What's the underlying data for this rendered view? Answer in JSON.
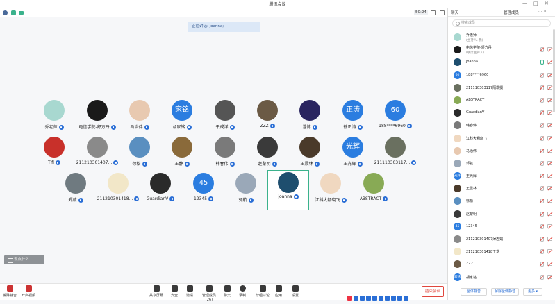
{
  "window": {
    "title": "腾讯会议"
  },
  "toolbar": {
    "timer": "50:24"
  },
  "speaking": {
    "label": "正在讲话: joanna;"
  },
  "participants": [
    {
      "name": "乔老师",
      "avatar_text": "",
      "color": "#a8d8d0"
    },
    {
      "name": "电信学院-舒方丹",
      "avatar_text": "",
      "color": "#1a1a1a"
    },
    {
      "name": "马治伟",
      "avatar_text": "",
      "color": "#e8c9b0"
    },
    {
      "name": "胡家铭",
      "avatar_text": "家铭",
      "color": "#2b7de0"
    },
    {
      "name": "于成洋",
      "avatar_text": "",
      "color": "#555555"
    },
    {
      "name": "ZZZ",
      "avatar_text": "",
      "color": "#6b5a45"
    },
    {
      "name": "潘博",
      "avatar_text": "",
      "color": "#2a2560"
    },
    {
      "name": "徐正涛",
      "avatar_text": "正涛",
      "color": "#2b7de0"
    },
    {
      "name": "188****6960",
      "avatar_text": "60",
      "color": "#2b7de0"
    },
    {
      "name": "Tifl",
      "avatar_text": "",
      "color": "#c8302a"
    },
    {
      "name": "211210301407...",
      "avatar_text": "",
      "color": "#8a8a8a"
    },
    {
      "name": "徐松",
      "avatar_text": "",
      "color": "#5a8fc0"
    },
    {
      "name": "王静",
      "avatar_text": "",
      "color": "#8a6a3a"
    },
    {
      "name": "韩春伟",
      "avatar_text": "",
      "color": "#7a7a7a"
    },
    {
      "name": "赵黎明",
      "avatar_text": "",
      "color": "#3a3a3a"
    },
    {
      "name": "王震林",
      "avatar_text": "",
      "color": "#4a3a2a"
    },
    {
      "name": "王光辉",
      "avatar_text": "光辉",
      "color": "#2b7de0"
    },
    {
      "name": "211110303117...",
      "avatar_text": "",
      "color": "#6a7060"
    },
    {
      "name": "郑威",
      "avatar_text": "",
      "color": "#6f7a80"
    },
    {
      "name": "211210301418...",
      "avatar_text": "",
      "color": "#f2e7c8"
    },
    {
      "name": "GuardianV",
      "avatar_text": "",
      "color": "#2a2a2a"
    },
    {
      "name": "12345",
      "avatar_text": "45",
      "color": "#2b7de0"
    },
    {
      "name": "郭航",
      "avatar_text": "",
      "color": "#9aa8b8"
    },
    {
      "name": "joanna",
      "avatar_text": "",
      "color": "#1e4e6e"
    },
    {
      "name": "江科大畅晓飞",
      "avatar_text": "",
      "color": "#f0d8c0"
    },
    {
      "name": "ABSTRACT",
      "avatar_text": "",
      "color": "#88aa55"
    }
  ],
  "bottombar": {
    "unmute": "解除静音",
    "video": "开启视频",
    "share": "共享屏幕",
    "security": "安全",
    "invite": "邀请",
    "members": "管理成员(26)",
    "chat": "聊天",
    "record": "录制",
    "breakout": "分组讨论",
    "apps": "应用",
    "settings": "设置",
    "end": "结束会议"
  },
  "chat_popup": "说点什么...",
  "panel": {
    "tab_chat": "聊天",
    "tab_members": "管理成员",
    "search_placeholder": "搜索成员",
    "members": [
      {
        "name": "乔老师",
        "sub": "(主持人, 我)",
        "color": "#a8d8d0",
        "text": "",
        "mic": "none"
      },
      {
        "name": "电信学院-舒方丹",
        "sub": "(联席主持人)",
        "color": "#1a1a1a",
        "text": "",
        "mic": "muted"
      },
      {
        "name": "joanna",
        "sub": "",
        "color": "#1e4e6e",
        "text": "",
        "mic": "on"
      },
      {
        "name": "188****6960",
        "sub": "",
        "color": "#2b7de0",
        "text": "60",
        "mic": "muted"
      },
      {
        "name": "211110303117隔霸摄",
        "sub": "",
        "color": "#6a7060",
        "text": "",
        "mic": "muted"
      },
      {
        "name": "ABSTRACT",
        "sub": "",
        "color": "#88aa55",
        "text": "",
        "mic": "muted"
      },
      {
        "name": "GuardianV",
        "sub": "",
        "color": "#2a2a2a",
        "text": "",
        "mic": "muted"
      },
      {
        "name": "韩春伟",
        "sub": "",
        "color": "#7a7a7a",
        "text": "",
        "mic": "muted"
      },
      {
        "name": "江科大畅晓飞",
        "sub": "",
        "color": "#f0d8c0",
        "text": "",
        "mic": "muted"
      },
      {
        "name": "马治伟",
        "sub": "",
        "color": "#e8c9b0",
        "text": "",
        "mic": "muted"
      },
      {
        "name": "郭航",
        "sub": "",
        "color": "#9aa8b8",
        "text": "",
        "mic": "muted"
      },
      {
        "name": "王光辉",
        "sub": "",
        "color": "#2b7de0",
        "text": "光辉",
        "mic": "muted"
      },
      {
        "name": "王震林",
        "sub": "",
        "color": "#4a3a2a",
        "text": "",
        "mic": "muted"
      },
      {
        "name": "徐松",
        "sub": "",
        "color": "#5a8fc0",
        "text": "",
        "mic": "muted"
      },
      {
        "name": "赵黎明",
        "sub": "",
        "color": "#3a3a3a",
        "text": "",
        "mic": "muted"
      },
      {
        "name": "12345",
        "sub": "",
        "color": "#2b7de0",
        "text": "45",
        "mic": "muted"
      },
      {
        "name": "211210301407薄志娟",
        "sub": "",
        "color": "#8a8a8a",
        "text": "",
        "mic": "muted"
      },
      {
        "name": "211210301418王龙",
        "sub": "",
        "color": "#f2e7c8",
        "text": "",
        "mic": "muted"
      },
      {
        "name": "ZZZ",
        "sub": "",
        "color": "#6b5a45",
        "text": "",
        "mic": "muted"
      },
      {
        "name": "胡家铭",
        "sub": "",
        "color": "#2b7de0",
        "text": "家铭",
        "mic": "muted"
      }
    ],
    "mute_all": "全体静音",
    "unmute_all": "解除全体静音",
    "more": "更多 ▾"
  }
}
